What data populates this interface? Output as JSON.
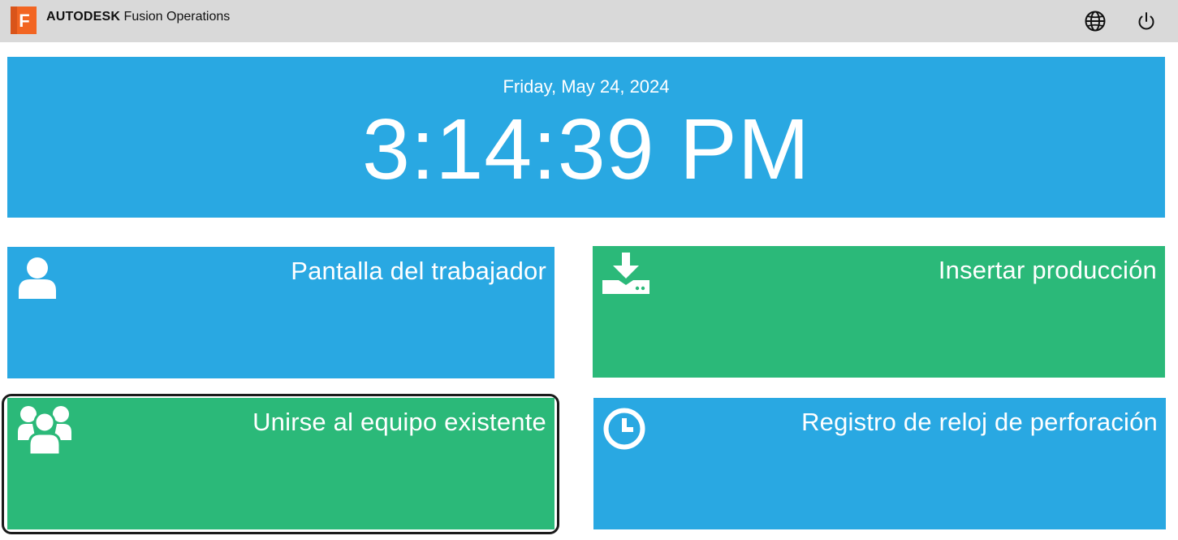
{
  "header": {
    "logo_letter": "F",
    "brand_bold": "AUTODESK",
    "brand_product": "Fusion Operations",
    "language_icon": "globe-icon",
    "logout_icon": "power-icon"
  },
  "clock": {
    "date": "Friday, May 24, 2024",
    "time": "3:14:39 PM"
  },
  "tiles": [
    {
      "label": "Pantalla del trabajador",
      "icon": "user-icon",
      "color": "#29a8e2"
    },
    {
      "label": "Insertar producción",
      "icon": "download-tray-icon",
      "color": "#2bb979"
    },
    {
      "label": "Unirse al equipo existente",
      "icon": "group-users-icon",
      "color": "#2bb979",
      "focused": true
    },
    {
      "label": "Registro de reloj de perforación",
      "icon": "clock-icon",
      "color": "#29a8e2"
    }
  ],
  "colors": {
    "topbar": "#d9d9d9",
    "blue": "#29a8e2",
    "green": "#2bb979",
    "logo_orange": "#f26522"
  }
}
